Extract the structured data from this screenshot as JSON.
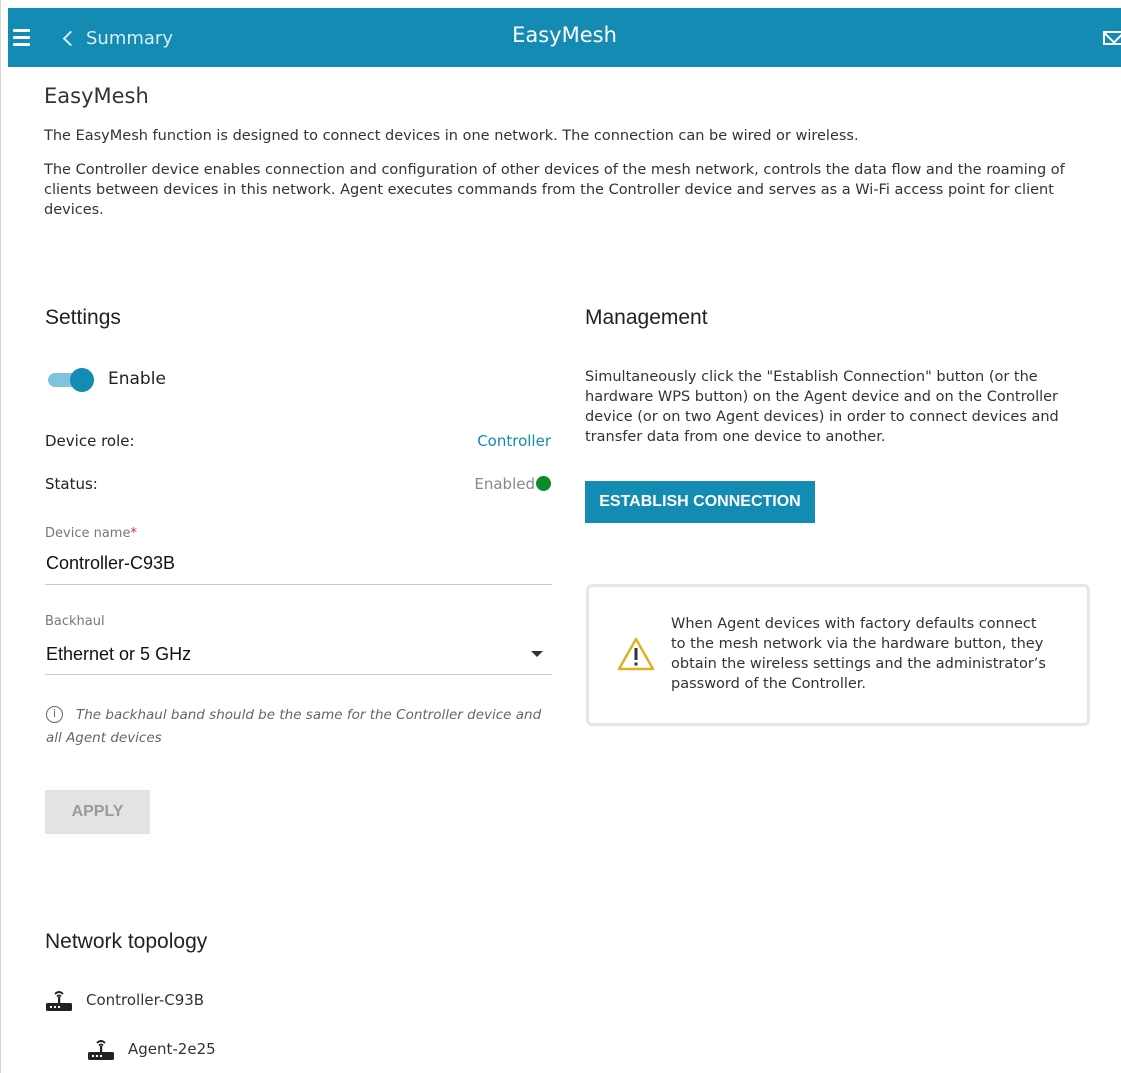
{
  "header": {
    "menu_icon": "hamburger-icon",
    "back_label": "Summary",
    "title": "EasyMesh",
    "mail_icon": "mail-icon",
    "background": "#148bb3"
  },
  "page": {
    "title": "EasyMesh",
    "intro": [
      "The EasyMesh function is designed to connect devices in one network. The connection can be wired or wireless.",
      "The Controller device enables connection and configuration of other devices of the mesh network, controls the data flow and the roaming of clients between devices in this network. Agent executes commands from the Controller device and serves as a Wi-Fi access point for client devices."
    ]
  },
  "settings": {
    "title": "Settings",
    "enable_label": "Enable",
    "enable_on": true,
    "device_role_label": "Device role:",
    "device_role_value": "Controller",
    "status_label": "Status:",
    "status_value": "Enabled",
    "status_color": "#0a8a2a",
    "device_name_label": "Device name",
    "required_mark": "*",
    "device_name_value": "Controller-C93B",
    "backhaul_label": "Backhaul",
    "backhaul_value": "Ethernet or 5 GHz",
    "hint": "The backhaul band should be the same for the Controller device and all Agent devices",
    "hint_icon": "info-icon",
    "apply_label": "APPLY"
  },
  "management": {
    "title": "Management",
    "description": "Simultaneously click the \"Establish Connection\" button (or the hardware WPS button) on the Agent device and on the Controller device (or on two Agent devices) in order to connect devices and transfer data from one device to another.",
    "establish_label": "ESTABLISH CONNECTION",
    "warning_icon": "warning-icon",
    "warning": "When Agent devices with factory defaults connect to the mesh network via the hardware button, they obtain the wireless settings and the administrator’s password of the Controller."
  },
  "topology": {
    "title": "Network topology",
    "nodes": [
      {
        "name": "Controller-C93B",
        "icon": "router-icon"
      },
      {
        "name": "Agent-2e25",
        "icon": "router-icon"
      }
    ]
  }
}
